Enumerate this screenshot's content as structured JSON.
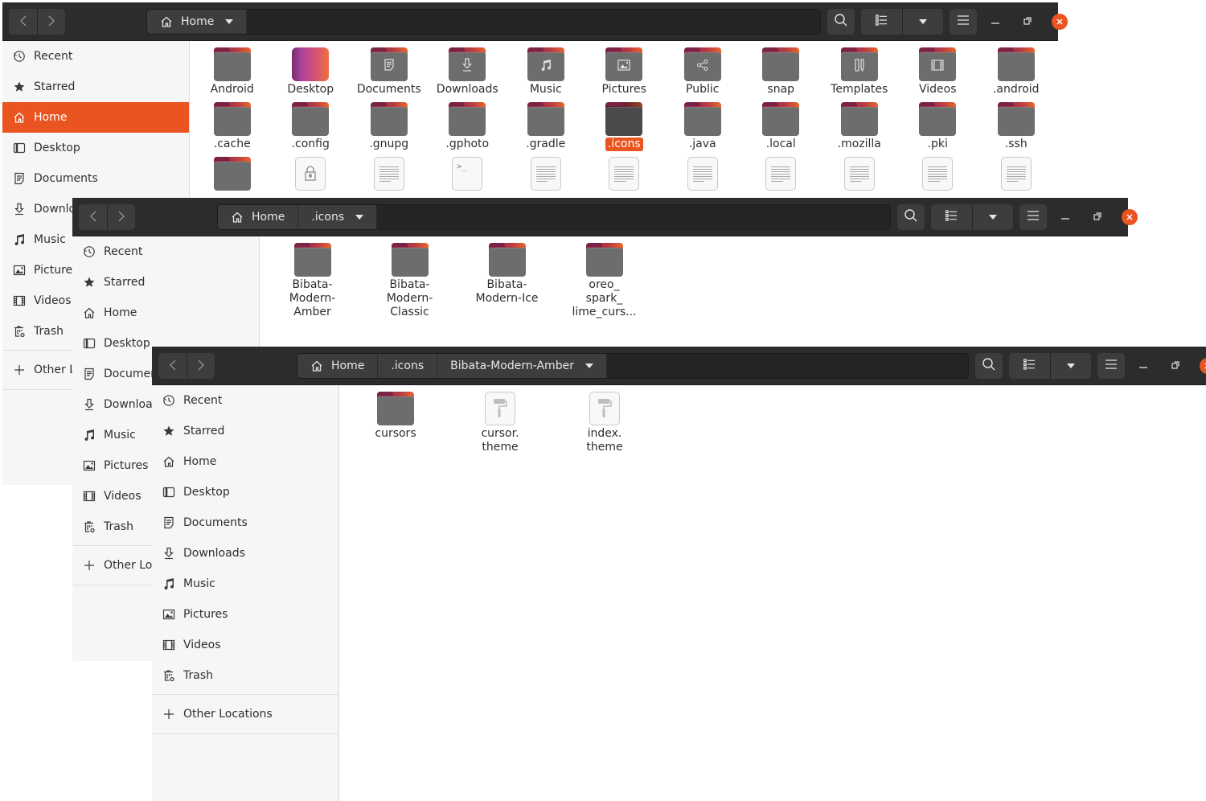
{
  "colors": {
    "accent": "#e95420",
    "headerbar": "#2c2c2c",
    "sidebar": "#f6f6f6"
  },
  "sidebar_items": [
    {
      "label": "Recent",
      "icon": "clock-icon"
    },
    {
      "label": "Starred",
      "icon": "star-icon"
    },
    {
      "label": "Home",
      "icon": "home-icon"
    },
    {
      "label": "Desktop",
      "icon": "desktop-icon"
    },
    {
      "label": "Documents",
      "icon": "document-icon"
    },
    {
      "label": "Downloads",
      "icon": "download-icon"
    },
    {
      "label": "Music",
      "icon": "music-icon"
    },
    {
      "label": "Pictures",
      "icon": "picture-icon"
    },
    {
      "label": "Videos",
      "icon": "video-icon"
    },
    {
      "label": "Trash",
      "icon": "trash-icon"
    }
  ],
  "other_locations": "Other Locations",
  "windows": [
    {
      "id": "home-window",
      "breadcrumbs": [
        "Home"
      ],
      "active_sidebar": "Home",
      "files": [
        {
          "name": "Android",
          "type": "folder"
        },
        {
          "name": "Desktop",
          "type": "desktop"
        },
        {
          "name": "Documents",
          "type": "folder",
          "emblem": "document"
        },
        {
          "name": "Downloads",
          "type": "folder",
          "emblem": "download"
        },
        {
          "name": "Music",
          "type": "folder",
          "emblem": "music"
        },
        {
          "name": "Pictures",
          "type": "folder",
          "emblem": "picture"
        },
        {
          "name": "Public",
          "type": "folder",
          "emblem": "share"
        },
        {
          "name": "snap",
          "type": "folder"
        },
        {
          "name": "Templates",
          "type": "folder",
          "emblem": "template"
        },
        {
          "name": "Videos",
          "type": "folder",
          "emblem": "video"
        },
        {
          "name": ".android",
          "type": "folder"
        },
        {
          "name": ".cache",
          "type": "folder"
        },
        {
          "name": ".config",
          "type": "folder"
        },
        {
          "name": ".gnupg",
          "type": "folder"
        },
        {
          "name": ".gphoto",
          "type": "folder"
        },
        {
          "name": ".gradle",
          "type": "folder"
        },
        {
          "name": ".icons",
          "type": "folder",
          "selected": true
        },
        {
          "name": ".java",
          "type": "folder"
        },
        {
          "name": ".local",
          "type": "folder"
        },
        {
          "name": ".mozilla",
          "type": "folder"
        },
        {
          "name": ".pki",
          "type": "folder"
        },
        {
          "name": ".ssh",
          "type": "folder"
        }
      ],
      "partial_row": [
        "folder",
        "pgp",
        "text",
        "script",
        "text",
        "text",
        "text",
        "text",
        "text",
        "text",
        "text"
      ],
      "pgp_label": "pgp",
      "script_glyph": ">_"
    },
    {
      "id": "icons-window",
      "breadcrumbs": [
        "Home",
        ".icons"
      ],
      "files": [
        {
          "name": "Bibata-Modern-Amber",
          "lines": [
            "Bibata-",
            "Modern-",
            "Amber"
          ]
        },
        {
          "name": "Bibata-Modern-Classic",
          "lines": [
            "Bibata-",
            "Modern-",
            "Classic"
          ]
        },
        {
          "name": "Bibata-Modern-Ice",
          "lines": [
            "Bibata-",
            "Modern-Ice"
          ]
        },
        {
          "name": "oreo_spark_lime_curs...",
          "lines": [
            "oreo_",
            "spark_",
            "lime_curs..."
          ]
        }
      ]
    },
    {
      "id": "amber-window",
      "breadcrumbs": [
        "Home",
        ".icons",
        "Bibata-Modern-Amber"
      ],
      "files": [
        {
          "name": "cursors",
          "type": "folder",
          "lines": [
            "cursors"
          ]
        },
        {
          "name": "cursor.theme",
          "type": "theme",
          "lines": [
            "cursor.",
            "theme"
          ]
        },
        {
          "name": "index.theme",
          "type": "theme",
          "lines": [
            "index.",
            "theme"
          ]
        }
      ]
    }
  ],
  "toolbar": {
    "search": "search-icon",
    "view": "list-view-icon",
    "view_options": "chevron-down-icon",
    "menu": "hamburger-menu-icon",
    "minimize": "minimize-icon",
    "maximize": "restore-icon",
    "close": "close-icon"
  }
}
